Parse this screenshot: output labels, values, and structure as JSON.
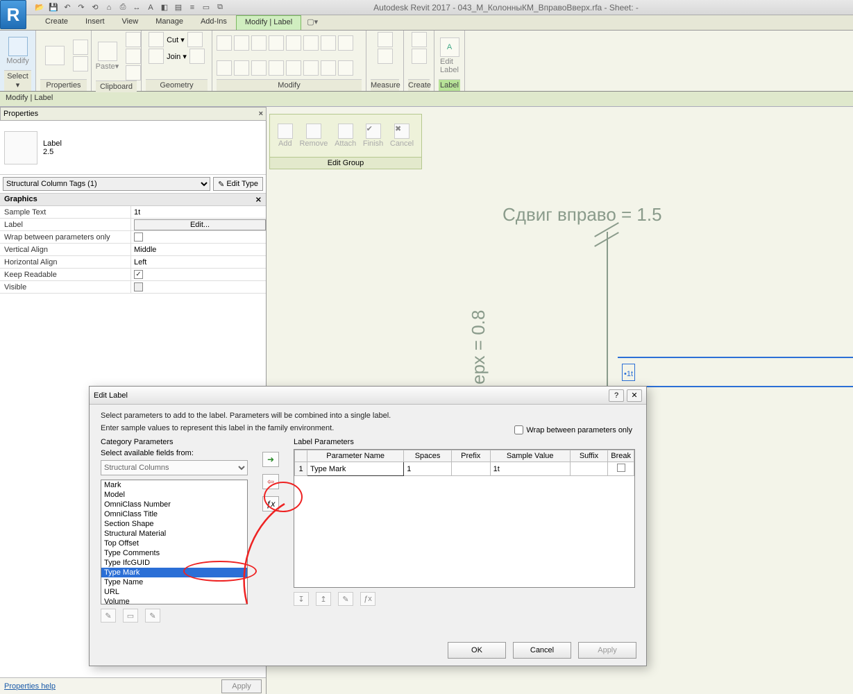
{
  "app": {
    "title": "Autodesk Revit 2017 -   043_M_КолонныКМ_ВправоВверх.rfa - Sheet:  -",
    "logo": "R"
  },
  "qat_icons": [
    "folder",
    "save",
    "undo",
    "redo",
    "sync",
    "home",
    "print",
    "dim",
    "text",
    "3d",
    "section",
    "close",
    "panel",
    "panel2"
  ],
  "tabs": {
    "items": [
      "Create",
      "Insert",
      "View",
      "Manage",
      "Add-Ins"
    ],
    "active": "Modify | Label",
    "ext_icon": "▾"
  },
  "ribbon": {
    "panels": [
      {
        "name": "Select ▾",
        "big": [
          {
            "ic": "cursor",
            "label": "Modify"
          }
        ],
        "cls": "sel-panel"
      },
      {
        "name": "Properties",
        "big": [
          {
            "ic": "props",
            "label": ""
          }
        ],
        "small_grid": true
      },
      {
        "name": "Clipboard",
        "big": [
          {
            "ic": "paste",
            "label": "Paste ▾"
          }
        ],
        "rows": [
          [
            "✂ Cut ▾"
          ],
          [
            "⧉",
            "Join ▾"
          ]
        ]
      },
      {
        "name": "Geometry",
        "rows": [
          [
            "⮐",
            "⮑"
          ],
          [
            "⧉",
            "🔗"
          ]
        ]
      },
      {
        "name": "Modify",
        "grid": true
      },
      {
        "name": "Measure",
        "big": [
          {
            "ic": "measure"
          }
        ]
      },
      {
        "name": "Create",
        "big": [
          {
            "ic": "create"
          }
        ]
      },
      {
        "name": "Label",
        "big": [
          {
            "ic": "A",
            "label": "Edit Label"
          }
        ],
        "cls": "label-panel"
      }
    ]
  },
  "context_bar": "Modify | Label",
  "properties": {
    "title": "Properties",
    "type_name": "Label",
    "type_size": "2.5",
    "instance_sel": "Structural Column Tags (1)",
    "edit_type": "Edit Type",
    "group": "Graphics",
    "rows": [
      {
        "k": "Sample Text",
        "v": "1t",
        "kind": "text"
      },
      {
        "k": "Label",
        "v": "Edit...",
        "kind": "btn"
      },
      {
        "k": "Wrap between parameters only",
        "v": "",
        "kind": "chk",
        "checked": false
      },
      {
        "k": "Vertical Align",
        "v": "Middle",
        "kind": "text"
      },
      {
        "k": "Horizontal Align",
        "v": "Left",
        "kind": "text"
      },
      {
        "k": "Keep Readable",
        "v": "",
        "kind": "chk",
        "checked": true
      },
      {
        "k": "Visible",
        "v": "",
        "kind": "chk",
        "checked": false,
        "dim": true
      }
    ],
    "help": "Properties help",
    "apply": "Apply"
  },
  "editgroup": {
    "buttons": [
      "Add",
      "Remove",
      "Attach",
      "Finish",
      "Cancel"
    ],
    "name": "Edit Group"
  },
  "canvas": {
    "dim_right": "Сдвиг вправо = 1.5",
    "dim_up": "ерх = 0.8",
    "label_text": "1t"
  },
  "dialog": {
    "title": "Edit Label",
    "info1": "Select parameters to add to the label.  Parameters will be combined into a single label.",
    "info2": "Enter sample values to represent this label in the family environment.",
    "wrap_label": "Wrap between parameters only",
    "left_header": "Category Parameters",
    "left_sub": "Select available fields from:",
    "combo": "Structural Columns",
    "params": [
      "Mark",
      "Model",
      "OmniClass Number",
      "OmniClass Title",
      "Section Shape",
      "Structural Material",
      "Top Offset",
      "Type Comments",
      "Type IfcGUID",
      "Type Mark",
      "Type Name",
      "URL",
      "Volume"
    ],
    "selected_param": "Type Mark",
    "mid_add": "➜",
    "mid_remove": "⇦",
    "mid_fx": "ƒx",
    "right_header": "Label Parameters",
    "cols": [
      "",
      "Parameter Name",
      "Spaces",
      "Prefix",
      "Sample Value",
      "Suffix",
      "Break"
    ],
    "row": {
      "n": "1",
      "name": "Type Mark",
      "spaces": "1",
      "prefix": "",
      "sample": "1t",
      "suffix": "",
      "break": false
    },
    "bottom_tools_left": [
      "✎",
      "▭",
      "✎"
    ],
    "bottom_tools_right": [
      "↧",
      "↥",
      "✎",
      "ƒx"
    ],
    "ok": "OK",
    "cancel": "Cancel",
    "apply": "Apply"
  }
}
